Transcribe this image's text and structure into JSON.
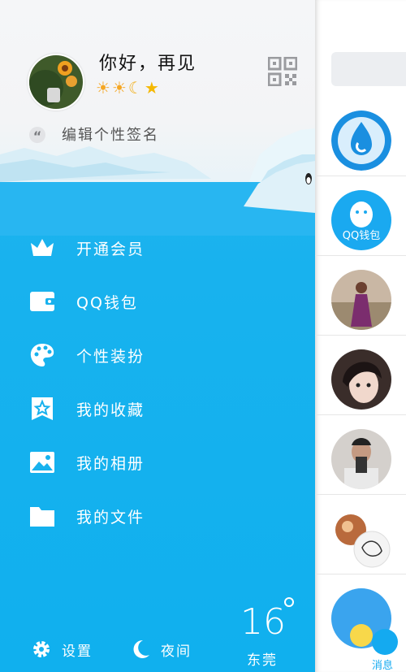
{
  "profile": {
    "nickname": "你好，再见",
    "level_badges": [
      "sun-icon",
      "sun-icon",
      "moon-icon",
      "star-icon"
    ],
    "signature": "编辑个性签名"
  },
  "menu": [
    {
      "label": "开通会员",
      "icon": "crown-icon"
    },
    {
      "label": "QQ钱包",
      "icon": "wallet-icon"
    },
    {
      "label": "个性装扮",
      "icon": "palette-icon"
    },
    {
      "label": "我的收藏",
      "icon": "favorites-icon"
    },
    {
      "label": "我的相册",
      "icon": "photo-album-icon"
    },
    {
      "label": "我的文件",
      "icon": "folder-icon"
    }
  ],
  "bottom": {
    "settings_label": "设置",
    "night_label": "夜间",
    "weather_temp": "16",
    "weather_city": "东莞"
  },
  "main_strip": {
    "wallet_label": "QQ钱包",
    "messages_label": "消息"
  },
  "colors": {
    "drawer_blue": "#18b2ee",
    "accent": "#14aaf0"
  }
}
